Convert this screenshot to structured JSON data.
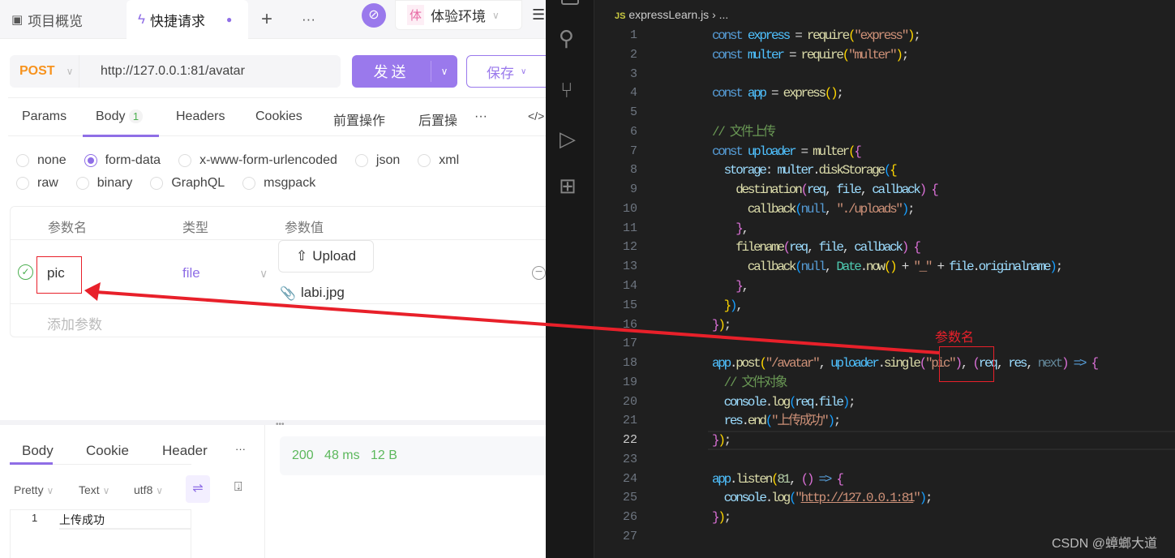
{
  "apifox": {
    "tabs": [
      {
        "label": "项目概览",
        "icon": "layout-icon"
      },
      {
        "label": "快捷请求",
        "icon": "lightning-icon",
        "unsaved": true
      }
    ],
    "add_tab": "+",
    "more": "···",
    "env": {
      "badge": "体",
      "label": "体验环境"
    },
    "request": {
      "method": "POST",
      "url": "http://127.0.0.1:81/avatar",
      "send": "发送",
      "save": "保存"
    },
    "req_tabs": [
      "Params",
      "Body",
      "Headers",
      "Cookies",
      "前置操作",
      "后置操"
    ],
    "body_count": "1",
    "code_icon": "</>",
    "body_types": [
      "none",
      "form-data",
      "x-www-form-urlencoded",
      "json",
      "xml",
      "raw",
      "binary",
      "GraphQL",
      "msgpack"
    ],
    "body_selected": "form-data",
    "table": {
      "headers": [
        "参数名",
        "类型",
        "参数值"
      ],
      "rows": [
        {
          "enabled": true,
          "name": "pic",
          "type": "file",
          "upload": "Upload",
          "file": "labi.jpg"
        }
      ],
      "add_placeholder": "添加参数"
    },
    "response": {
      "tabs": [
        "Body",
        "Cookie",
        "Header"
      ],
      "status": "200",
      "time": "48 ms",
      "size": "12 B",
      "format": "Pretty",
      "type": "Text",
      "encoding": "utf8",
      "line_no": "1",
      "content": "上传成功"
    },
    "accent": "#8f6ee6"
  },
  "vscode": {
    "breadcrumb": {
      "file": "expressLearn.js",
      "rest": "..."
    },
    "current_line": 22,
    "lines": [
      [
        [
          "const",
          "k"
        ],
        [
          " ",
          ""
        ],
        [
          "express",
          "v"
        ],
        [
          " = ",
          ""
        ],
        [
          "require",
          "f"
        ],
        [
          "(",
          "b1"
        ],
        [
          "\"express\"",
          "s"
        ],
        [
          ")",
          "b1"
        ],
        [
          ";",
          ""
        ]
      ],
      [
        [
          "const",
          "k"
        ],
        [
          " ",
          ""
        ],
        [
          "multer",
          "v"
        ],
        [
          " = ",
          ""
        ],
        [
          "require",
          "f"
        ],
        [
          "(",
          "b1"
        ],
        [
          "\"multer\"",
          "s"
        ],
        [
          ")",
          "b1"
        ],
        [
          ";",
          ""
        ]
      ],
      [],
      [
        [
          "const",
          "k"
        ],
        [
          " ",
          ""
        ],
        [
          "app",
          "v"
        ],
        [
          " = ",
          ""
        ],
        [
          "express",
          "f"
        ],
        [
          "()",
          "b1"
        ],
        [
          ";",
          ""
        ]
      ],
      [],
      [
        [
          "// 文件上传",
          "c"
        ]
      ],
      [
        [
          "const",
          "k"
        ],
        [
          " ",
          ""
        ],
        [
          "uploader",
          "v"
        ],
        [
          " = ",
          ""
        ],
        [
          "multer",
          "f"
        ],
        [
          "(",
          "b1"
        ],
        [
          "{",
          "b2"
        ]
      ],
      [
        [
          "  storage",
          "p"
        ],
        [
          ": ",
          ""
        ],
        [
          "multer",
          "p"
        ],
        [
          ".",
          ""
        ],
        [
          "diskStorage",
          "f"
        ],
        [
          "(",
          "b3"
        ],
        [
          "{",
          "b1"
        ]
      ],
      [
        [
          "    destination",
          "f"
        ],
        [
          "(",
          "b2"
        ],
        [
          "req",
          "p"
        ],
        [
          ", ",
          ""
        ],
        [
          "file",
          "p"
        ],
        [
          ", ",
          ""
        ],
        [
          "callback",
          "p"
        ],
        [
          ")",
          "b2"
        ],
        [
          " ",
          ""
        ],
        [
          "{",
          "b2"
        ]
      ],
      [
        [
          "      callback",
          "f"
        ],
        [
          "(",
          "b3"
        ],
        [
          "null",
          "k"
        ],
        [
          ", ",
          ""
        ],
        [
          "\"./uploads\"",
          "s"
        ],
        [
          ")",
          "b3"
        ],
        [
          ";",
          ""
        ]
      ],
      [
        [
          "    }",
          "b2"
        ],
        [
          ",",
          ""
        ]
      ],
      [
        [
          "    filename",
          "f"
        ],
        [
          "(",
          "b2"
        ],
        [
          "req",
          "p"
        ],
        [
          ", ",
          ""
        ],
        [
          "file",
          "p"
        ],
        [
          ", ",
          ""
        ],
        [
          "callback",
          "p"
        ],
        [
          ")",
          "b2"
        ],
        [
          " ",
          ""
        ],
        [
          "{",
          "b2"
        ]
      ],
      [
        [
          "      callback",
          "f"
        ],
        [
          "(",
          "b3"
        ],
        [
          "null",
          "k"
        ],
        [
          ", ",
          ""
        ],
        [
          "Date",
          "cl"
        ],
        [
          ".",
          ""
        ],
        [
          "now",
          "f"
        ],
        [
          "()",
          "b1"
        ],
        [
          " + ",
          ""
        ],
        [
          "\"_\"",
          "s"
        ],
        [
          " + ",
          ""
        ],
        [
          "file",
          "p"
        ],
        [
          ".",
          ""
        ],
        [
          "originalname",
          "p"
        ],
        [
          ")",
          "b3"
        ],
        [
          ";",
          ""
        ]
      ],
      [
        [
          "    }",
          "b2"
        ],
        [
          ",",
          ""
        ]
      ],
      [
        [
          "  }",
          "b1"
        ],
        [
          ")",
          "b3"
        ],
        [
          ",",
          ""
        ]
      ],
      [
        [
          "}",
          "b2"
        ],
        [
          ")",
          "b1"
        ],
        [
          ";",
          ""
        ]
      ],
      [],
      [
        [
          "app",
          "v"
        ],
        [
          ".",
          ""
        ],
        [
          "post",
          "f"
        ],
        [
          "(",
          "b1"
        ],
        [
          "\"/avatar\"",
          "s"
        ],
        [
          ", ",
          ""
        ],
        [
          "uploader",
          "v"
        ],
        [
          ".",
          ""
        ],
        [
          "single",
          "f"
        ],
        [
          "(",
          "b2"
        ],
        [
          "\"pic\"",
          "s"
        ],
        [
          ")",
          "b2"
        ],
        [
          ", ",
          ""
        ],
        [
          "(",
          "b2"
        ],
        [
          "req",
          "p"
        ],
        [
          ", ",
          ""
        ],
        [
          "res",
          "p"
        ],
        [
          ", ",
          ""
        ],
        [
          "next",
          "dim"
        ],
        [
          ")",
          "b2"
        ],
        [
          " ",
          ""
        ],
        [
          "=>",
          "k"
        ],
        [
          " ",
          ""
        ],
        [
          "{",
          "b2"
        ]
      ],
      [
        [
          "  // 文件对象",
          "c"
        ]
      ],
      [
        [
          "  console",
          "p"
        ],
        [
          ".",
          ""
        ],
        [
          "log",
          "f"
        ],
        [
          "(",
          "b3"
        ],
        [
          "req",
          "p"
        ],
        [
          ".",
          ""
        ],
        [
          "file",
          "p"
        ],
        [
          ")",
          "b3"
        ],
        [
          ";",
          ""
        ]
      ],
      [
        [
          "  res",
          "p"
        ],
        [
          ".",
          ""
        ],
        [
          "end",
          "f"
        ],
        [
          "(",
          "b3"
        ],
        [
          "\"上传成功\"",
          "s"
        ],
        [
          ")",
          "b3"
        ],
        [
          ";",
          ""
        ]
      ],
      [
        [
          "}",
          "b2"
        ],
        [
          ")",
          "b1"
        ],
        [
          ";",
          ""
        ]
      ],
      [],
      [
        [
          "app",
          "v"
        ],
        [
          ".",
          ""
        ],
        [
          "listen",
          "f"
        ],
        [
          "(",
          "b1"
        ],
        [
          "81",
          "n"
        ],
        [
          ", ",
          ""
        ],
        [
          "()",
          "b2"
        ],
        [
          " ",
          ""
        ],
        [
          "=>",
          "k"
        ],
        [
          " ",
          ""
        ],
        [
          "{",
          "b2"
        ]
      ],
      [
        [
          "  console",
          "p"
        ],
        [
          ".",
          ""
        ],
        [
          "log",
          "f"
        ],
        [
          "(",
          "b3"
        ],
        [
          "\"",
          ""
        ],
        [
          "http://127.0.0.1:81",
          "u"
        ],
        [
          "\"",
          "s"
        ],
        [
          ")",
          "b3"
        ],
        [
          ";",
          ""
        ]
      ],
      [
        [
          "}",
          "b2"
        ],
        [
          ")",
          "b1"
        ],
        [
          ";",
          ""
        ]
      ],
      []
    ]
  },
  "annotation": {
    "label": "参数名",
    "color": "#e8202a"
  },
  "watermark": "CSDN @蟑螂大道"
}
